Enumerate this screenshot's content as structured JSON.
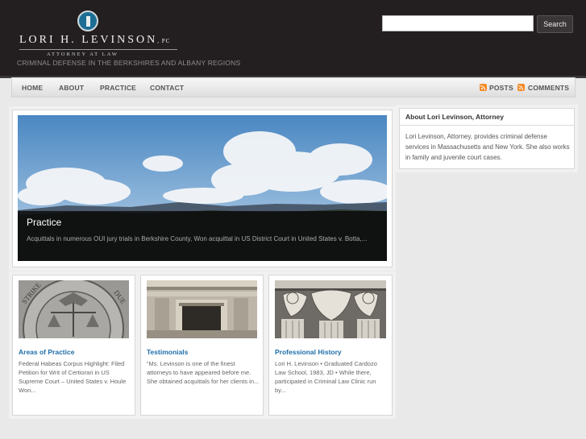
{
  "header": {
    "logo_name": "LORI H. LEVINSON",
    "logo_suffix": "PC",
    "logo_sub": "ATTORNEY AT LAW",
    "tagline": "CRIMINAL DEFENSE IN THE BERKSHIRES AND ALBANY REGIONS",
    "search_placeholder": "",
    "search_button": "Search"
  },
  "nav": {
    "items": [
      {
        "label": "HOME"
      },
      {
        "label": "ABOUT"
      },
      {
        "label": "PRACTICE"
      },
      {
        "label": "CONTACT"
      }
    ],
    "feeds": [
      {
        "label": "POSTS",
        "icon": "rss-icon"
      },
      {
        "label": "COMMENTS",
        "icon": "rss-icon"
      }
    ]
  },
  "slider": {
    "title": "Practice",
    "text": "Acquittals in numerous OUI jury trials in Berkshire County, Won acquittal in US District Court in United States v. Botta,..."
  },
  "cards": [
    {
      "title": "Areas of Practice",
      "text": "Federal Habeas Corpus Highlight: Filed Petition for Writ of Certiorari in US Supreme Court – United States v. Houle Won...",
      "image": "seal-icon"
    },
    {
      "title": "Testimonials",
      "text": "“Ms. Levinson is one of the finest attorneys to have appeared before me. She obtained acquittals for her clients in...",
      "image": "courthouse-door-image"
    },
    {
      "title": "Professional History",
      "text": "Lori H. Levinson • Graduated Cardozo Law School, 1983, JD • While there, participated in Criminal Law Clinic run by...",
      "image": "corinthian-capital-image"
    }
  ],
  "sidebar": {
    "title": "About Lori Levinson, Attorney",
    "text": "Lori Levinson, Attorney, provides criminal defense services in Massachusetts and New York. She also works in family and juvenile court cases."
  },
  "colors": {
    "header_bg": "#231f20",
    "link_blue": "#1f6ea8",
    "rss_orange": "#f48a26",
    "logo_blue": "#1d6e95"
  }
}
